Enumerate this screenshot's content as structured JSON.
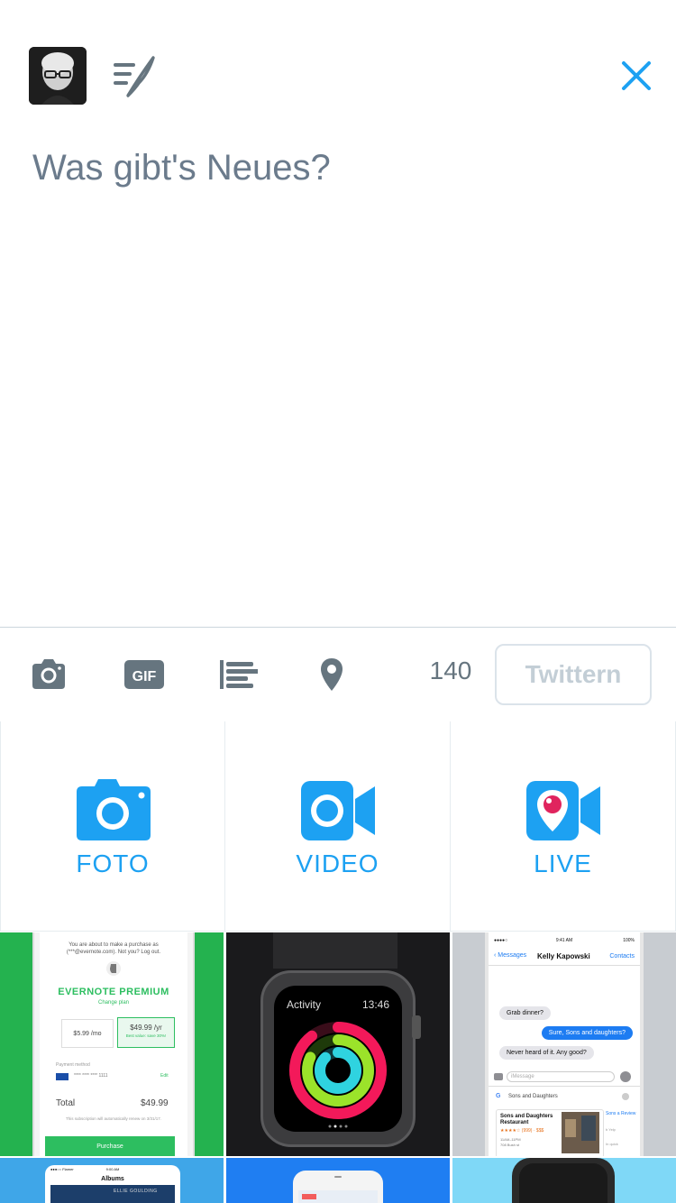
{
  "header": {
    "avatar_alt": "Profile photo",
    "drafts_icon": "drafts-quill-icon",
    "close_icon": "close-icon"
  },
  "compose": {
    "placeholder": "Was gibt's Neues?"
  },
  "toolbar": {
    "icons": [
      "camera-icon",
      "gif-icon",
      "poll-icon",
      "location-pin-icon"
    ],
    "char_count": "140",
    "tweet_label": "Twittern"
  },
  "media": {
    "photo_label": "FOTO",
    "video_label": "VIDEO",
    "live_label": "LIVE"
  },
  "thumbs": {
    "evernote": {
      "purchase_line1": "You are about to make a purchase as",
      "purchase_line2": "(***@evernote.com). Not you? Log out.",
      "title": "EVERNOTE PREMIUM",
      "change_plan": "Change plan",
      "monthly": "$5.99 /mo",
      "yearly": "$49.99 /yr",
      "best_value": "Best value: save 30%!",
      "payment_method": "Payment method",
      "card": "**** **** **** 1111",
      "edit": "Edit",
      "total_label": "Total",
      "total_value": "$49.99",
      "renew": "This subscription will automatically renew on 3/31/17.",
      "purchase": "Purchase"
    },
    "watch": {
      "activity": "Activity",
      "time": "13:46"
    },
    "messages": {
      "status_time": "9:41 AM",
      "battery": "100%",
      "back": "Messages",
      "contact": "Kelly Kapowski",
      "contacts_link": "Contacts",
      "msg1": "Grab dinner?",
      "msg2": "Sure, Sons and daughters?",
      "msg3": "Never heard of it. Any good?",
      "input_placeholder": "iMessage",
      "search": "Sons and Daughters",
      "result_title": "Sons and Daughters Restaurant",
      "result_rating": "★★★★☆ (999) · $$$",
      "result_hours": "11AM–11PM",
      "result_address": "708 Bush st",
      "side_title": "Sons a Review",
      "side_sub": "b Yelp",
      "side_sub2": "In quick"
    },
    "albums": {
      "carrier": "Flamer",
      "time": "9:00 AM",
      "title": "Albums",
      "artist": "ELLIE GOULDING"
    }
  },
  "colors": {
    "accent": "#1da1f2",
    "placeholder": "#6b7b8c",
    "icon_gray": "#66757f",
    "evernote_green": "#2dbe60"
  }
}
